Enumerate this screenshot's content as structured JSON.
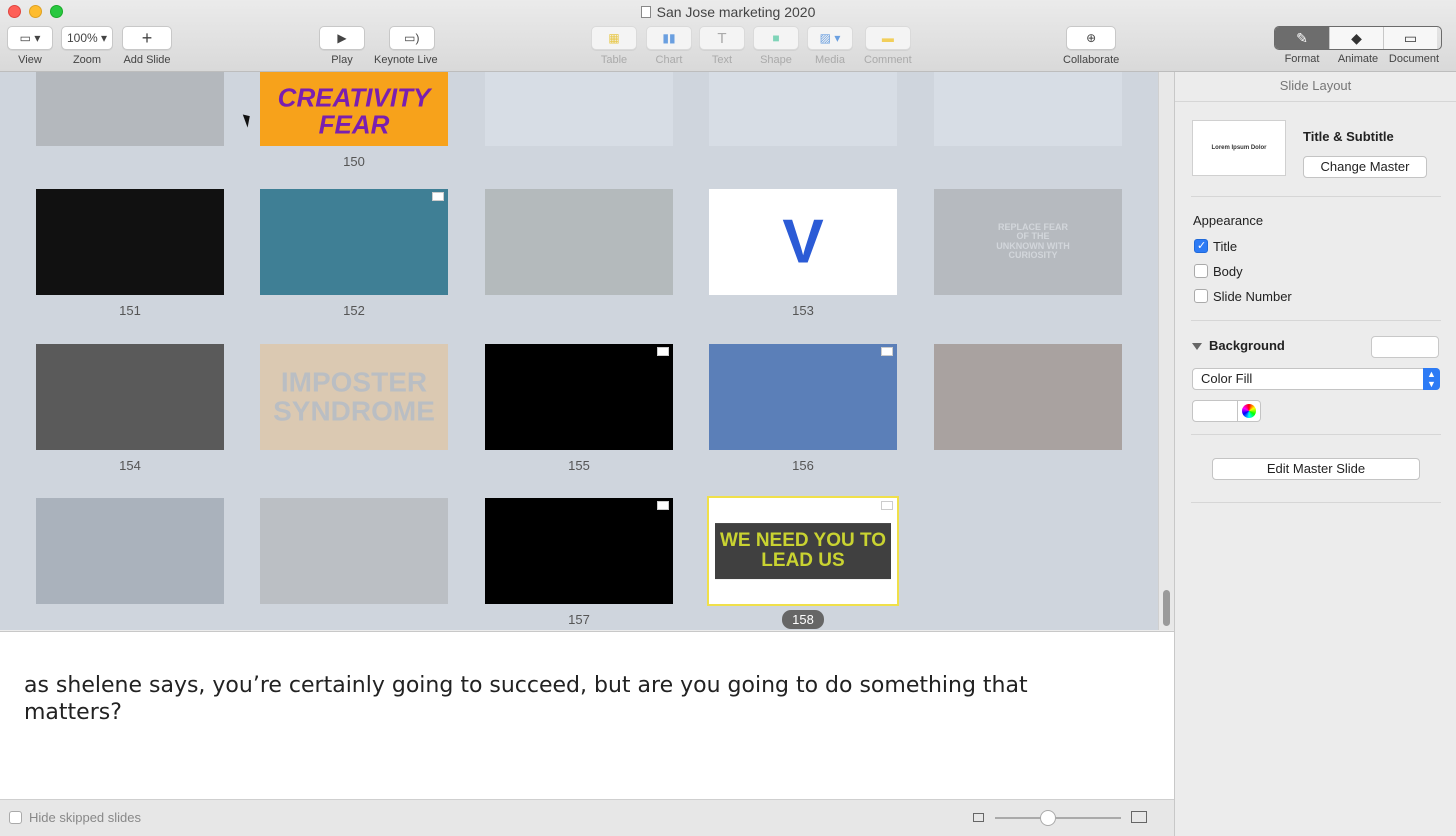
{
  "window": {
    "title": "San Jose marketing 2020"
  },
  "toolbar": {
    "view_label": "View",
    "zoom_value": "100%",
    "zoom_label": "Zoom",
    "add_slide_label": "Add Slide",
    "play_label": "Play",
    "keynote_live_label": "Keynote Live",
    "table_label": "Table",
    "chart_label": "Chart",
    "text_label": "Text",
    "shape_label": "Shape",
    "media_label": "Media",
    "comment_label": "Comment",
    "collaborate_label": "Collaborate",
    "format_label": "Format",
    "animate_label": "Animate",
    "document_label": "Document"
  },
  "slides": {
    "row0": [
      {
        "number": "",
        "skipped": true,
        "bg": "#8a8a8a",
        "text": ""
      },
      {
        "number": "150",
        "skipped": false,
        "bg": "#f7a21b",
        "text": "CREATIVITY FEAR"
      },
      {
        "number": "",
        "skipped": true,
        "bg": "#e6ebf2",
        "text": ""
      },
      {
        "number": "",
        "skipped": true,
        "bg": "#e6ebf2",
        "text": ""
      },
      {
        "number": "",
        "skipped": true,
        "bg": "#e6ebf2",
        "text": ""
      }
    ],
    "row1": [
      {
        "number": "151",
        "skipped": false,
        "bg": "#111111",
        "text": ""
      },
      {
        "number": "152",
        "skipped": false,
        "bg": "#3f7f95",
        "text": ""
      },
      {
        "number": "",
        "skipped": true,
        "bg": "#8a8f86",
        "text": ""
      },
      {
        "number": "153",
        "skipped": false,
        "bg": "#ffffff",
        "text": "V"
      },
      {
        "number": "",
        "skipped": true,
        "bg": "#8f8f8f",
        "text": "REPLACE FEAR OF THE UNKNOWN WITH CURIOSITY"
      }
    ],
    "row2": [
      {
        "number": "154",
        "skipped": false,
        "bg": "#5a5a5a",
        "text": ""
      },
      {
        "number": "",
        "skipped": true,
        "bg": "#f0b86e",
        "text": "IMPOSTER SYNDROME"
      },
      {
        "number": "155",
        "skipped": false,
        "bg": "#000000",
        "text": ""
      },
      {
        "number": "156",
        "skipped": false,
        "bg": "#5b7fb8",
        "text": ""
      },
      {
        "number": "",
        "skipped": true,
        "bg": "#6b4e3c",
        "text": ""
      }
    ],
    "row3": [
      {
        "number": "",
        "skipped": true,
        "bg": "#6e7885",
        "text": ""
      },
      {
        "number": "",
        "skipped": true,
        "bg": "#9a9a9a",
        "text": ""
      },
      {
        "number": "157",
        "skipped": false,
        "bg": "#000000",
        "text": ""
      },
      {
        "number": "158",
        "skipped": false,
        "bg": "#ffffff",
        "text": "WE NEED YOU TO LEAD US",
        "selected": true
      }
    ]
  },
  "notes": {
    "text": "as shelene says, you’re certainly going to succeed, but are you going to do something that matters?"
  },
  "bottom": {
    "hide_skipped_label": "Hide skipped slides",
    "zoom_level": 0.42
  },
  "inspector": {
    "header": "Slide Layout",
    "master_thumb_text": "Lorem Ipsum Dolor",
    "master_title": "Title & Subtitle",
    "change_master_label": "Change Master",
    "appearance_label": "Appearance",
    "checkbox_title": "Title",
    "checkbox_body": "Body",
    "checkbox_slide_number": "Slide Number",
    "background_label": "Background",
    "fill_select_value": "Color Fill",
    "edit_master_label": "Edit Master Slide"
  }
}
